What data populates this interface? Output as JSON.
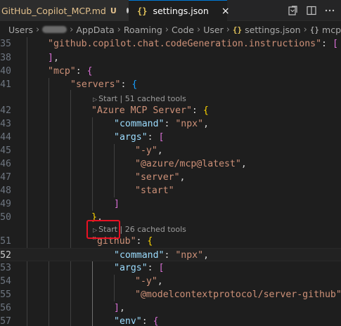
{
  "tabs": [
    {
      "name": "GitHub_Copilot_MCP.md",
      "status": "U"
    },
    {
      "name": "settings.json",
      "icon": "json-braces-icon",
      "close": "×"
    }
  ],
  "breadcrumb": {
    "items": [
      "Users",
      "AppData",
      "Roaming",
      "Code",
      "User",
      "settings.json",
      "mcp"
    ],
    "braces": "{}",
    "sym": "{}"
  },
  "lens": {
    "first": {
      "start": "Start",
      "sep": "|",
      "tools": "51 cached tools"
    },
    "second": {
      "start": "Start",
      "sep": "|",
      "tools": "26 cached tools"
    }
  },
  "lines": [
    {
      "n": "35",
      "tokens": [
        [
          "s",
          "\"github.copilot.chat.codeGeneration.instructions\""
        ],
        [
          "p",
          ": "
        ],
        [
          "b2",
          "["
        ]
      ]
    },
    {
      "n": "38",
      "tokens": [
        [
          "b2",
          "]"
        ],
        [
          "p",
          ","
        ]
      ]
    },
    {
      "n": "40",
      "tokens": [
        [
          "s",
          "\"mcp\""
        ],
        [
          "p",
          ": "
        ],
        [
          "b2",
          "{"
        ]
      ]
    },
    {
      "n": "41",
      "tokens": [
        [
          "s",
          "\"servers\""
        ],
        [
          "p",
          ": "
        ],
        [
          "b3",
          "{"
        ]
      ]
    },
    {
      "n": "42",
      "tokens": [
        [
          "s",
          "\"Azure MCP Server\""
        ],
        [
          "p",
          ": "
        ],
        [
          "b1",
          "{"
        ]
      ]
    },
    {
      "n": "43",
      "tokens": [
        [
          "k",
          "\"command\""
        ],
        [
          "p",
          ": "
        ],
        [
          "s",
          "\"npx\""
        ],
        [
          "p",
          ","
        ]
      ]
    },
    {
      "n": "44",
      "tokens": [
        [
          "k",
          "\"args\""
        ],
        [
          "p",
          ": "
        ],
        [
          "b2",
          "["
        ]
      ]
    },
    {
      "n": "45",
      "tokens": [
        [
          "s",
          "\"-y\""
        ],
        [
          "p",
          ","
        ]
      ]
    },
    {
      "n": "46",
      "tokens": [
        [
          "s",
          "\"@azure/mcp@latest\""
        ],
        [
          "p",
          ","
        ]
      ]
    },
    {
      "n": "47",
      "tokens": [
        [
          "s",
          "\"server\""
        ],
        [
          "p",
          ","
        ]
      ]
    },
    {
      "n": "48",
      "tokens": [
        [
          "s",
          "\"start\""
        ]
      ]
    },
    {
      "n": "49",
      "tokens": [
        [
          "b2",
          "]"
        ]
      ]
    },
    {
      "n": "50",
      "tokens": [
        [
          "b1",
          "}"
        ],
        [
          "p",
          ","
        ]
      ]
    },
    {
      "n": "51",
      "tokens": [
        [
          "s",
          "\"github\""
        ],
        [
          "p",
          ": "
        ],
        [
          "b1",
          "{"
        ]
      ]
    },
    {
      "n": "52",
      "tokens": [
        [
          "k",
          "\"command\""
        ],
        [
          "p",
          ": "
        ],
        [
          "s",
          "\"npx\""
        ],
        [
          "p",
          ","
        ]
      ]
    },
    {
      "n": "53",
      "tokens": [
        [
          "k",
          "\"args\""
        ],
        [
          "p",
          ": "
        ],
        [
          "b2",
          "["
        ]
      ]
    },
    {
      "n": "54",
      "tokens": [
        [
          "s",
          "\"-y\""
        ],
        [
          "p",
          ","
        ]
      ]
    },
    {
      "n": "55",
      "tokens": [
        [
          "s",
          "\"@modelcontextprotocol/server-github\""
        ]
      ]
    },
    {
      "n": "56",
      "tokens": [
        [
          "b2",
          "]"
        ],
        [
          "p",
          ","
        ]
      ]
    },
    {
      "n": "57",
      "tokens": [
        [
          "k",
          "\"env\""
        ],
        [
          "p",
          ": "
        ],
        [
          "b2",
          "{"
        ]
      ]
    }
  ],
  "current_line": "52",
  "colors": {
    "background": "#1e1e1e",
    "key": "#9cdcfe",
    "string": "#ce9178",
    "highlight_box": "#e81123",
    "tab_modified": "#e2c08d",
    "tab_active_border": "#0078d4"
  }
}
